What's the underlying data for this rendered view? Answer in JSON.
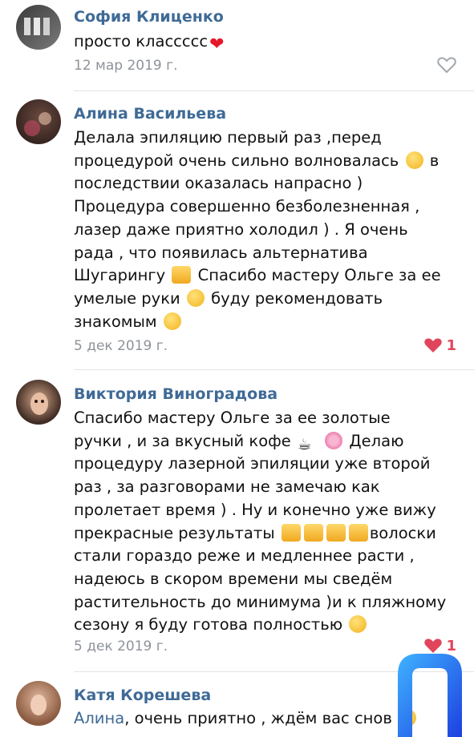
{
  "comments": [
    {
      "author": "София Клиценко",
      "text": [
        "просто классссс"
      ],
      "trailing_emoji": "red-heart",
      "date": "12 мар 2019 г.",
      "likes": "",
      "liked": false
    },
    {
      "author": "Алина Васильева",
      "text": [
        "Делала эпиляцию первый раз ,перед",
        "процедурой очень сильно волновалась",
        "в",
        "последствии оказалась напрасно )",
        "Процедура совершенно безболезненная ,",
        "лазер даже приятно холодил ) . Я очень",
        "рада , что появилась альтернатива",
        "Шугарингу",
        "Спасибо мастеру Ольге за ее",
        "умелые руки",
        "буду рекомендовать",
        "знакомым"
      ],
      "date": "5 дек 2019 г.",
      "likes": "1",
      "liked": true
    },
    {
      "author": "Виктория Виноградова",
      "text": [
        "Спасибо мастеру Ольге за ее золотые",
        "ручки , и за вкусный кофе",
        "Делаю",
        "процедуру лазерной эпиляции уже второй",
        "раз , за разговорами не замечаю как",
        "пролетает время ) . Ну и конечно уже вижу",
        "прекрасные результаты",
        "волоски",
        "стали гораздо реже и медленнее расти ,",
        "надеюсь в скором времени мы сведём",
        "растительность до минимума )и к пляжному",
        "сезону я буду готова полностью"
      ],
      "date": "5 дек 2019 г.",
      "likes": "1",
      "liked": true
    },
    {
      "author": "Катя Корешева",
      "mention": "Алина",
      "text": [
        ", очень приятно , ждём вас снов"
      ],
      "date": "",
      "likes": "",
      "liked": false
    }
  ],
  "colors": {
    "name": "#3f6a96",
    "date": "#8e9399",
    "like_active": "#e0455c",
    "logo_blue": "#1d6cf2"
  }
}
